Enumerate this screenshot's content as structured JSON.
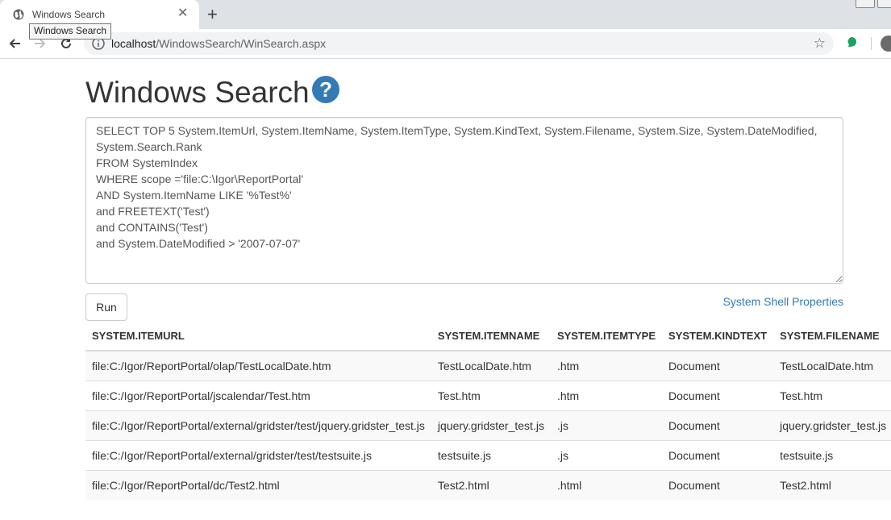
{
  "browser": {
    "tab_title": "Windows Search",
    "tooltip": "Windows Search",
    "url_host": "localhost",
    "url_path": "/WindowsSearch/WinSearch.aspx"
  },
  "page": {
    "title": "Windows Search",
    "help_glyph": "?",
    "query": "SELECT TOP 5 System.ItemUrl, System.ItemName, System.ItemType, System.KindText, System.Filename, System.Size, System.DateModified,\nSystem.Search.Rank\nFROM SystemIndex\nWHERE scope ='file:C:\\Igor\\ReportPortal'\nAND System.ItemName LIKE '%Test%'\nand FREETEXT('Test')\nand CONTAINS('Test')\nand System.DateModified > '2007-07-07'",
    "run_label": "Run",
    "props_link": "System Shell Properties"
  },
  "table": {
    "headers": [
      "SYSTEM.ITEMURL",
      "SYSTEM.ITEMNAME",
      "SYSTEM.ITEMTYPE",
      "SYSTEM.KINDTEXT",
      "SYSTEM.FILENAME"
    ],
    "rows": [
      [
        "file:C:/Igor/ReportPortal/olap/TestLocalDate.htm",
        "TestLocalDate.htm",
        ".htm",
        "Document",
        "TestLocalDate.htm"
      ],
      [
        "file:C:/Igor/ReportPortal/jscalendar/Test.htm",
        "Test.htm",
        ".htm",
        "Document",
        "Test.htm"
      ],
      [
        "file:C:/Igor/ReportPortal/external/gridster/test/jquery.gridster_test.js",
        "jquery.gridster_test.js",
        ".js",
        "Document",
        "jquery.gridster_test.js"
      ],
      [
        "file:C:/Igor/ReportPortal/external/gridster/test/testsuite.js",
        "testsuite.js",
        ".js",
        "Document",
        "testsuite.js"
      ],
      [
        "file:C:/Igor/ReportPortal/dc/Test2.html",
        "Test2.html",
        ".html",
        "Document",
        "Test2.html"
      ]
    ]
  }
}
